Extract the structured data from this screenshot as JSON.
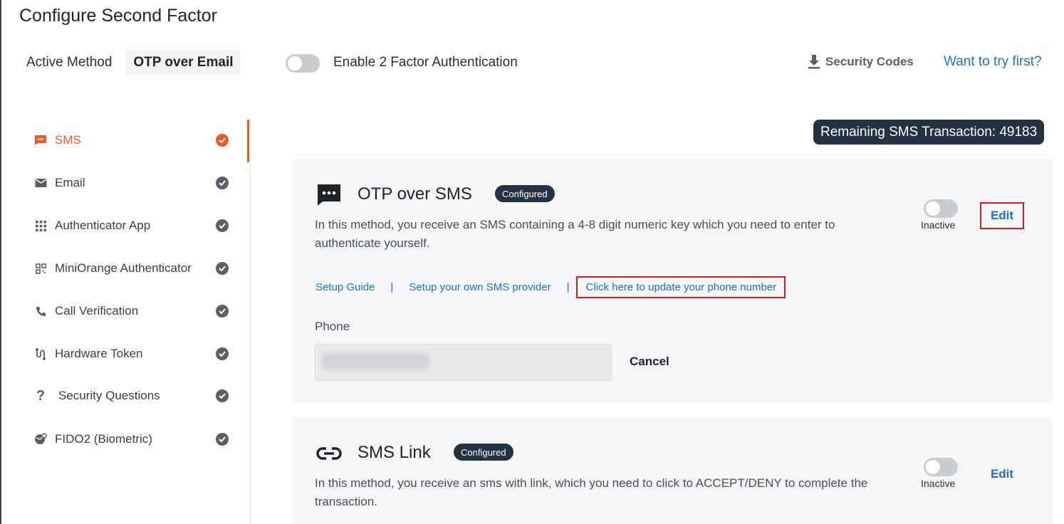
{
  "page": {
    "title": "Configure Second Factor"
  },
  "active": {
    "label": "Active Method",
    "value": "OTP over Email"
  },
  "two_factor": {
    "label": "Enable 2 Factor Authentication",
    "enabled": false
  },
  "header_actions": {
    "security_codes": "Security Codes",
    "try_first": "Want to try first?"
  },
  "sidebar": {
    "items": [
      {
        "label": "SMS",
        "icon": "sms-icon",
        "active": true
      },
      {
        "label": "Email",
        "icon": "email-icon",
        "active": false
      },
      {
        "label": "Authenticator App",
        "icon": "grid-icon",
        "active": false
      },
      {
        "label": "MiniOrange Authenticator",
        "icon": "qr-icon",
        "active": false
      },
      {
        "label": "Call Verification",
        "icon": "phone-icon",
        "active": false
      },
      {
        "label": "Hardware Token",
        "icon": "token-icon",
        "active": false
      },
      {
        "label": "Security Questions",
        "icon": "question-icon",
        "active": false
      },
      {
        "label": "FIDO2 (Biometric)",
        "icon": "fingerprint-globe-icon",
        "active": false
      }
    ]
  },
  "remaining": {
    "text": "Remaining SMS Transaction: 49183"
  },
  "methods": [
    {
      "title": "OTP over SMS",
      "badge": "Configured",
      "icon": "sms-chat-icon",
      "description": "In this method, you receive an SMS containing a 4-8 digit numeric key which you need to enter to authenticate yourself.",
      "status": "Inactive",
      "edit": "Edit",
      "links": {
        "setup_guide": "Setup Guide",
        "sep": "|",
        "own_provider": "Setup your own SMS provider",
        "update_phone": "Click here to update your phone number"
      },
      "phone_label": "Phone",
      "cancel": "Cancel"
    },
    {
      "title": "SMS Link",
      "badge": "Configured",
      "icon": "link-icon",
      "description": "In this method, you receive an sms with link, which you need to click to ACCEPT/DENY to complete the transaction.",
      "status": "Inactive",
      "edit": "Edit"
    }
  ],
  "colors": {
    "accent": "#e85d1f",
    "link": "#1f6fd0",
    "badge": "#243342",
    "highlight_box": "#e0151c"
  }
}
